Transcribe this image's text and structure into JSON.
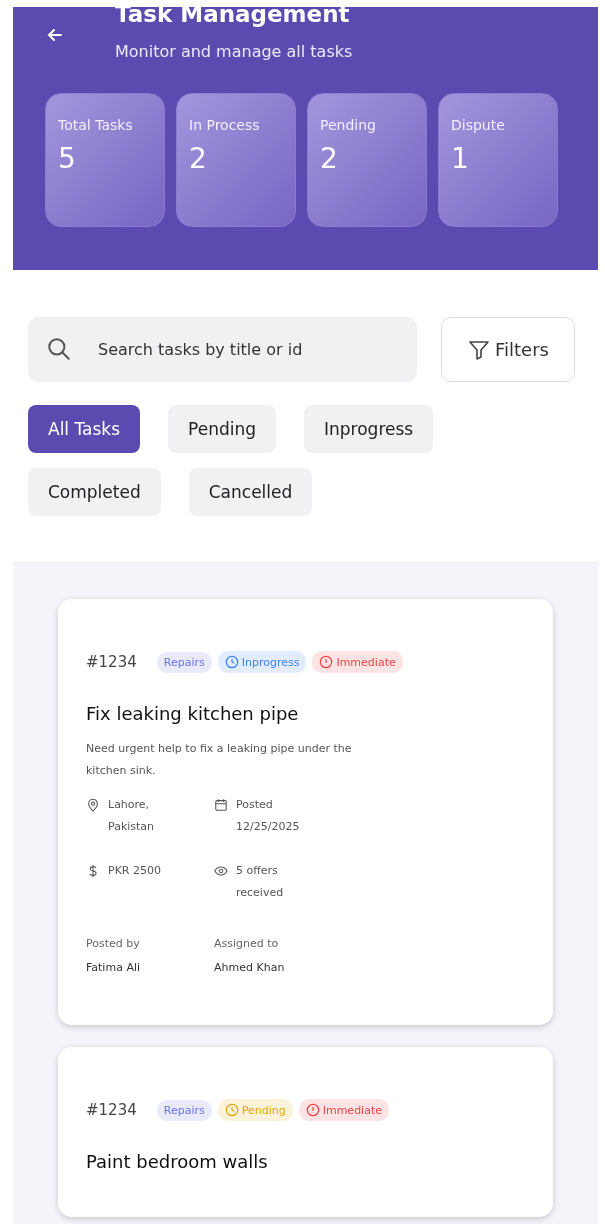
{
  "header": {
    "title": "Task Management",
    "subtitle": "Monitor and manage all tasks"
  },
  "stats": [
    {
      "label": "Total Tasks",
      "value": "5"
    },
    {
      "label": "In Process",
      "value": "2"
    },
    {
      "label": "Pending",
      "value": "2"
    },
    {
      "label": "Dispute",
      "value": "1"
    }
  ],
  "search": {
    "placeholder": "Search tasks by title or id"
  },
  "filters_button": "Filters",
  "chips": [
    {
      "label": "All Tasks",
      "selected": true
    },
    {
      "label": "Pending",
      "selected": false
    },
    {
      "label": "Inprogress",
      "selected": false
    },
    {
      "label": "Completed",
      "selected": false
    },
    {
      "label": "Cancelled",
      "selected": false
    }
  ],
  "tasks": [
    {
      "id": "#1234",
      "tags": [
        {
          "label": "Repairs",
          "kind": "plain",
          "color": "#6b72e8"
        },
        {
          "label": "Inprogress",
          "kind": "clock",
          "color": "#3b82f6"
        },
        {
          "label": "Immediate",
          "kind": "alert",
          "color": "#ef4444"
        }
      ],
      "title": "Fix leaking kitchen pipe",
      "description": "Need urgent help to fix a leaking pipe under the kitchen sink.",
      "location": "Lahore, Pakistan",
      "posted": "Posted 12/25/2025",
      "budget": "PKR 2500",
      "offers": "5 offers received",
      "posted_by_label": "Posted by",
      "posted_by": "Fatima Ali",
      "assigned_label": "Assigned to",
      "assigned_to": "Ahmed Khan"
    },
    {
      "id": "#1234",
      "tags": [
        {
          "label": "Repairs",
          "kind": "plain",
          "color": "#6b72e8"
        },
        {
          "label": "Pending",
          "kind": "clock",
          "color": "#e0a800"
        },
        {
          "label": "Immediate",
          "kind": "alert",
          "color": "#ef4444"
        }
      ],
      "title": "Paint bedroom walls"
    }
  ]
}
